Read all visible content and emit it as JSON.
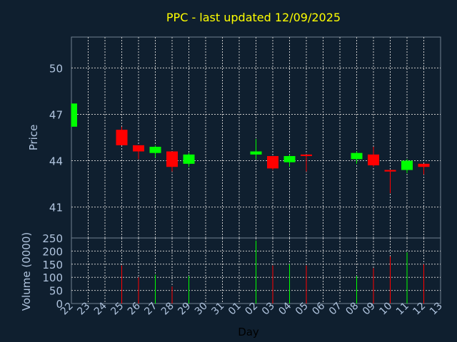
{
  "chart_data": {
    "type": "candlestick",
    "title": "PPC - last updated 12/09/2025",
    "xlabel": "Day",
    "x_ticks": [
      "22",
      "23",
      "24",
      "25",
      "26",
      "27",
      "28",
      "29",
      "30",
      "31",
      "01",
      "02",
      "03",
      "04",
      "05",
      "06",
      "07",
      "08",
      "09",
      "10",
      "11",
      "12",
      "13"
    ],
    "price": {
      "ylabel": "Price",
      "ylim": [
        39,
        52
      ],
      "yticks": [
        "41",
        "44",
        "47",
        "50"
      ],
      "candles": [
        {
          "day": "22",
          "open": 46.2,
          "high": 47.7,
          "low": 46.2,
          "close": 47.7
        },
        {
          "day": "25",
          "open": 46.0,
          "high": 46.2,
          "low": 45.0,
          "close": 45.0
        },
        {
          "day": "26",
          "open": 45.0,
          "high": 45.0,
          "low": 44.1,
          "close": 44.6
        },
        {
          "day": "27",
          "open": 44.5,
          "high": 45.0,
          "low": 44.2,
          "close": 44.9
        },
        {
          "day": "28",
          "open": 44.6,
          "high": 44.6,
          "low": 43.3,
          "close": 43.6
        },
        {
          "day": "29",
          "open": 43.8,
          "high": 44.5,
          "low": 43.6,
          "close": 44.4
        },
        {
          "day": "02",
          "open": 44.4,
          "high": 45.4,
          "low": 44.1,
          "close": 44.6
        },
        {
          "day": "03",
          "open": 44.3,
          "high": 44.3,
          "low": 43.4,
          "close": 43.5
        },
        {
          "day": "04",
          "open": 43.9,
          "high": 44.4,
          "low": 43.6,
          "close": 44.3
        },
        {
          "day": "05",
          "open": 44.4,
          "high": 44.4,
          "low": 43.3,
          "close": 44.3
        },
        {
          "day": "08",
          "open": 44.1,
          "high": 44.6,
          "low": 43.8,
          "close": 44.5
        },
        {
          "day": "09",
          "open": 44.4,
          "high": 44.9,
          "low": 43.6,
          "close": 43.7
        },
        {
          "day": "10",
          "open": 43.4,
          "high": 43.4,
          "low": 41.9,
          "close": 43.3
        },
        {
          "day": "11",
          "open": 43.4,
          "high": 44.1,
          "low": 43.2,
          "close": 44.0
        },
        {
          "day": "12",
          "open": 43.8,
          "high": 43.8,
          "low": 43.1,
          "close": 43.6
        }
      ]
    },
    "volume": {
      "ylabel": "Volume (0000)",
      "ylim": [
        0,
        250
      ],
      "yticks": [
        "0",
        "50",
        "100",
        "150",
        "200",
        "250"
      ],
      "bars": [
        {
          "day": "25",
          "value": 145,
          "direction": "down"
        },
        {
          "day": "26",
          "value": 100,
          "direction": "down"
        },
        {
          "day": "27",
          "value": 110,
          "direction": "up"
        },
        {
          "day": "28",
          "value": 65,
          "direction": "down"
        },
        {
          "day": "29",
          "value": 105,
          "direction": "up"
        },
        {
          "day": "02",
          "value": 240,
          "direction": "up"
        },
        {
          "day": "03",
          "value": 145,
          "direction": "down"
        },
        {
          "day": "04",
          "value": 150,
          "direction": "up"
        },
        {
          "day": "05",
          "value": 145,
          "direction": "down"
        },
        {
          "day": "08",
          "value": 105,
          "direction": "up"
        },
        {
          "day": "09",
          "value": 135,
          "direction": "down"
        },
        {
          "day": "10",
          "value": 180,
          "direction": "down"
        },
        {
          "day": "11",
          "value": 195,
          "direction": "up"
        },
        {
          "day": "12",
          "value": 150,
          "direction": "down"
        }
      ]
    },
    "grid": true,
    "colors": {
      "background": "#0f1f2f",
      "plot_border": "#708090",
      "grid": "#c8c8c8",
      "up": "#00ff00",
      "down": "#ff0000",
      "title": "#ffff00",
      "axis_text": "#b0c4de"
    }
  }
}
